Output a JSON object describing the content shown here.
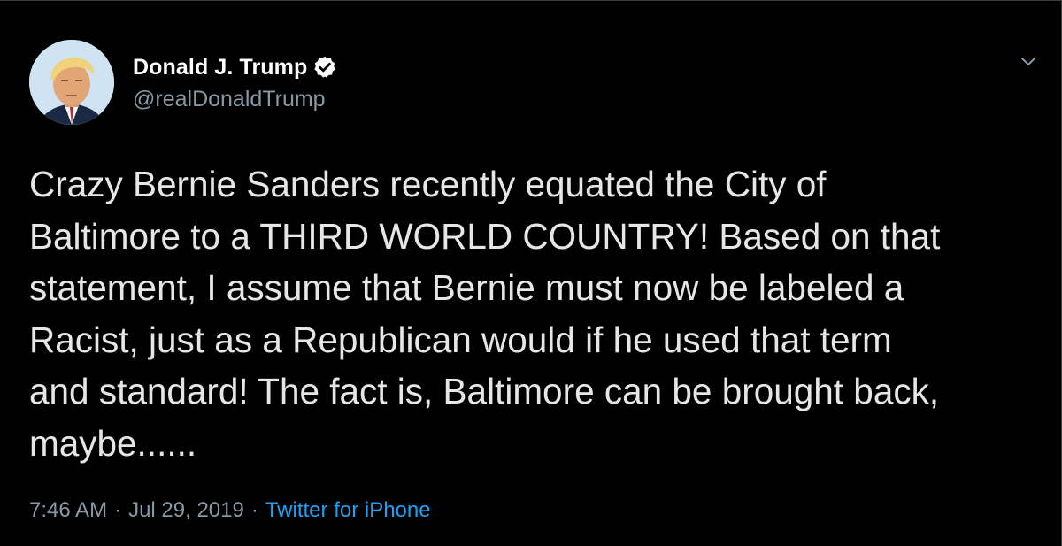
{
  "tweet": {
    "author": {
      "display_name": "Donald J. Trump",
      "handle": "@realDonaldTrump",
      "verified": true
    },
    "text": "Crazy Bernie Sanders recently equated the City of\nBaltimore to a THIRD WORLD COUNTRY! Based on that\nstatement, I assume that Bernie must now be labeled a\nRacist, just as a Republican would if he used that term\nand standard! The fact is, Baltimore can be brought back,\nmaybe......",
    "time": "7:46 AM",
    "separator": "·",
    "date": "Jul 29, 2019",
    "source": "Twitter for iPhone"
  },
  "icons": {
    "verified": "verified-badge-icon",
    "menu": "chevron-down-icon"
  },
  "colors": {
    "background": "#000000",
    "text": "#e6e6e6",
    "muted": "#8899a6",
    "link": "#1da1f2"
  }
}
